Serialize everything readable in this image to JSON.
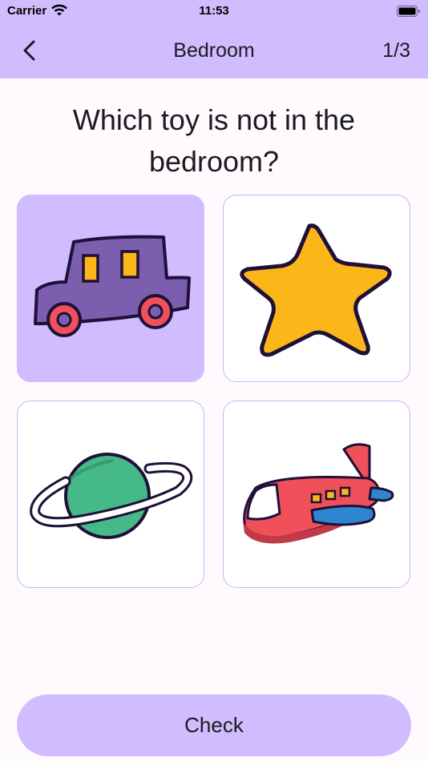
{
  "status_bar": {
    "carrier": "Carrier",
    "time": "11:53"
  },
  "header": {
    "title": "Bedroom",
    "progress": "1/3",
    "back_icon": "chevron-left-icon"
  },
  "question": "Which toy is not in the bedroom?",
  "options": [
    {
      "icon": "toy-car-icon",
      "selected": true
    },
    {
      "icon": "star-icon",
      "selected": false
    },
    {
      "icon": "planet-icon",
      "selected": false
    },
    {
      "icon": "airplane-icon",
      "selected": false
    }
  ],
  "check_label": "Check",
  "colors": {
    "accent": "#d0bcfe",
    "background": "#fefafe",
    "card_border": "#c9b6ef",
    "text": "#1c1b20"
  }
}
